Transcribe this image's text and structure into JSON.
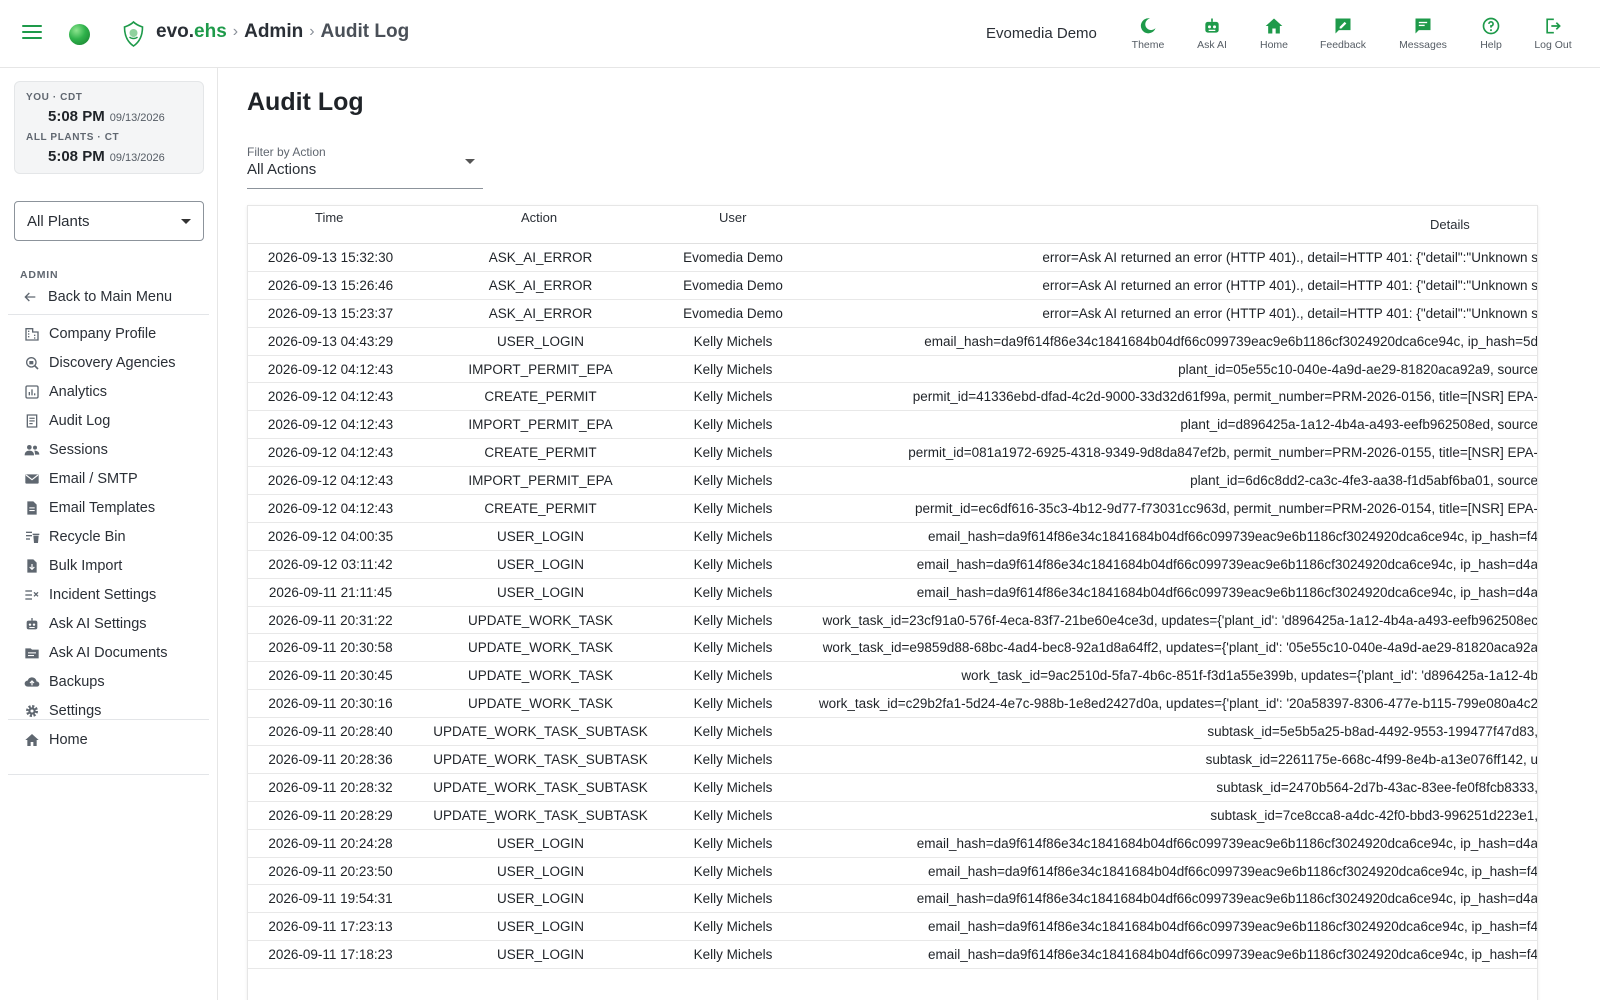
{
  "brand": {
    "prefix": "evo.",
    "suffix": "ehs",
    "crumb_admin": "Admin",
    "crumb_current": "Audit Log"
  },
  "account": {
    "name": "Evomedia Demo"
  },
  "actions": [
    {
      "label": "Theme",
      "icon": "moon-icon"
    },
    {
      "label": "Ask AI",
      "icon": "robot-icon"
    },
    {
      "label": "Home",
      "icon": "home-icon"
    },
    {
      "label": "Feedback",
      "icon": "feedback-icon"
    },
    {
      "label": "Messages",
      "icon": "message-icon"
    },
    {
      "label": "Help",
      "icon": "help-icon"
    },
    {
      "label": "Log Out",
      "icon": "logout-icon"
    }
  ],
  "clock": {
    "you_label": "YOU · CDT",
    "you_time": "5:08 PM",
    "you_date": "09/13/2026",
    "plants_label": "ALL PLANTS · CT",
    "plants_time": "5:08 PM",
    "plants_date": "09/13/2026"
  },
  "plant_select": {
    "value": "All Plants"
  },
  "sidebar": {
    "section_label": "ADMIN",
    "back_label": "Back to Main Menu",
    "items": [
      {
        "label": "Company Profile",
        "icon": "building-icon"
      },
      {
        "label": "Discovery Agencies",
        "icon": "agency-search-icon"
      },
      {
        "label": "Analytics",
        "icon": "analytics-icon"
      },
      {
        "label": "Audit Log",
        "icon": "document-icon"
      },
      {
        "label": "Sessions",
        "icon": "people-icon"
      },
      {
        "label": "Email / SMTP",
        "icon": "email-icon"
      },
      {
        "label": "Email Templates",
        "icon": "template-icon"
      },
      {
        "label": "Recycle Bin",
        "icon": "recycle-bin-icon"
      },
      {
        "label": "Bulk Import",
        "icon": "import-icon"
      },
      {
        "label": "Incident Settings",
        "icon": "incident-settings-icon"
      },
      {
        "label": "Ask AI Settings",
        "icon": "robot-icon"
      },
      {
        "label": "Ask AI Documents",
        "icon": "folder-icon"
      },
      {
        "label": "Backups",
        "icon": "cloud-backup-icon"
      },
      {
        "label": "Settings",
        "icon": "gear-icon"
      }
    ],
    "home_label": "Home"
  },
  "main": {
    "title": "Audit Log",
    "filter": {
      "label": "Filter by Action",
      "value": "All Actions"
    },
    "columns": {
      "time": "Time",
      "action": "Action",
      "user": "User",
      "details": "Details"
    },
    "rows": [
      {
        "time": "2026-09-13 15:32:30",
        "action": "ASK_AI_ERROR",
        "user": "Evomedia Demo",
        "details": "error=Ask AI returned an error (HTTP 401)., detail=HTTP 401: {\"detail\":\"Unknown s"
      },
      {
        "time": "2026-09-13 15:26:46",
        "action": "ASK_AI_ERROR",
        "user": "Evomedia Demo",
        "details": "error=Ask AI returned an error (HTTP 401)., detail=HTTP 401: {\"detail\":\"Unknown s"
      },
      {
        "time": "2026-09-13 15:23:37",
        "action": "ASK_AI_ERROR",
        "user": "Evomedia Demo",
        "details": "error=Ask AI returned an error (HTTP 401)., detail=HTTP 401: {\"detail\":\"Unknown s"
      },
      {
        "time": "2026-09-13 04:43:29",
        "action": "USER_LOGIN",
        "user": "Kelly Michels",
        "details": "email_hash=da9f614f86e34c1841684b04df66c099739eac9e6b1186cf3024920dca6ce94c, ip_hash=5d"
      },
      {
        "time": "2026-09-12 04:12:43",
        "action": "IMPORT_PERMIT_EPA",
        "user": "Kelly Michels",
        "details": "plant_id=05e55c10-040e-4a9d-ae29-81820aca92a9, source"
      },
      {
        "time": "2026-09-12 04:12:43",
        "action": "CREATE_PERMIT",
        "user": "Kelly Michels",
        "details": "permit_id=41336ebd-dfad-4c2d-9000-33d32d61f99a, permit_number=PRM-2026-0156, title=[NSR] EPA-"
      },
      {
        "time": "2026-09-12 04:12:43",
        "action": "IMPORT_PERMIT_EPA",
        "user": "Kelly Michels",
        "details": "plant_id=d896425a-1a12-4b4a-a493-eefb962508ed, source"
      },
      {
        "time": "2026-09-12 04:12:43",
        "action": "CREATE_PERMIT",
        "user": "Kelly Michels",
        "details": "permit_id=081a1972-6925-4318-9349-9d8da847ef2b, permit_number=PRM-2026-0155, title=[NSR] EPA-"
      },
      {
        "time": "2026-09-12 04:12:43",
        "action": "IMPORT_PERMIT_EPA",
        "user": "Kelly Michels",
        "details": "plant_id=6d6c8dd2-ca3c-4fe3-aa38-f1d5abf6ba01, source"
      },
      {
        "time": "2026-09-12 04:12:43",
        "action": "CREATE_PERMIT",
        "user": "Kelly Michels",
        "details": "permit_id=ec6df616-35c3-4b12-9d77-f73031cc963d, permit_number=PRM-2026-0154, title=[NSR] EPA-"
      },
      {
        "time": "2026-09-12 04:00:35",
        "action": "USER_LOGIN",
        "user": "Kelly Michels",
        "details": "email_hash=da9f614f86e34c1841684b04df66c099739eac9e6b1186cf3024920dca6ce94c, ip_hash=f4"
      },
      {
        "time": "2026-09-12 03:11:42",
        "action": "USER_LOGIN",
        "user": "Kelly Michels",
        "details": "email_hash=da9f614f86e34c1841684b04df66c099739eac9e6b1186cf3024920dca6ce94c, ip_hash=d4a"
      },
      {
        "time": "2026-09-11 21:11:45",
        "action": "USER_LOGIN",
        "user": "Kelly Michels",
        "details": "email_hash=da9f614f86e34c1841684b04df66c099739eac9e6b1186cf3024920dca6ce94c, ip_hash=d4a"
      },
      {
        "time": "2026-09-11 20:31:22",
        "action": "UPDATE_WORK_TASK",
        "user": "Kelly Michels",
        "details": "work_task_id=23cf91a0-576f-4eca-83f7-21be60e4ce3d, updates={'plant_id': 'd896425a-1a12-4b4a-a493-eefb962508ec"
      },
      {
        "time": "2026-09-11 20:30:58",
        "action": "UPDATE_WORK_TASK",
        "user": "Kelly Michels",
        "details": "work_task_id=e9859d88-68bc-4ad4-bec8-92a1d8a64ff2, updates={'plant_id': '05e55c10-040e-4a9d-ae29-81820aca92a"
      },
      {
        "time": "2026-09-11 20:30:45",
        "action": "UPDATE_WORK_TASK",
        "user": "Kelly Michels",
        "details": "work_task_id=9ac2510d-5fa7-4b6c-851f-f3d1a55e399b, updates={'plant_id': 'd896425a-1a12-4b"
      },
      {
        "time": "2026-09-11 20:30:16",
        "action": "UPDATE_WORK_TASK",
        "user": "Kelly Michels",
        "details": "work_task_id=c29b2fa1-5d24-4e7c-988b-1e8ed2427d0a, updates={'plant_id': '20a58397-8306-477e-b115-799e080a4c2"
      },
      {
        "time": "2026-09-11 20:28:40",
        "action": "UPDATE_WORK_TASK_SUBTASK",
        "user": "Kelly Michels",
        "details": "subtask_id=5e5b5a25-b8ad-4492-9553-199477f47d83,"
      },
      {
        "time": "2026-09-11 20:28:36",
        "action": "UPDATE_WORK_TASK_SUBTASK",
        "user": "Kelly Michels",
        "details": "subtask_id=2261175e-668c-4f99-8e4b-a13e076ff142, u"
      },
      {
        "time": "2026-09-11 20:28:32",
        "action": "UPDATE_WORK_TASK_SUBTASK",
        "user": "Kelly Michels",
        "details": "subtask_id=2470b564-2d7b-43ac-83ee-fe0f8fcb8333,"
      },
      {
        "time": "2026-09-11 20:28:29",
        "action": "UPDATE_WORK_TASK_SUBTASK",
        "user": "Kelly Michels",
        "details": "subtask_id=7ce8cca8-a4dc-42f0-bbd3-996251d223e1,"
      },
      {
        "time": "2026-09-11 20:24:28",
        "action": "USER_LOGIN",
        "user": "Kelly Michels",
        "details": "email_hash=da9f614f86e34c1841684b04df66c099739eac9e6b1186cf3024920dca6ce94c, ip_hash=d4a"
      },
      {
        "time": "2026-09-11 20:23:50",
        "action": "USER_LOGIN",
        "user": "Kelly Michels",
        "details": "email_hash=da9f614f86e34c1841684b04df66c099739eac9e6b1186cf3024920dca6ce94c, ip_hash=f4"
      },
      {
        "time": "2026-09-11 19:54:31",
        "action": "USER_LOGIN",
        "user": "Kelly Michels",
        "details": "email_hash=da9f614f86e34c1841684b04df66c099739eac9e6b1186cf3024920dca6ce94c, ip_hash=d4a"
      },
      {
        "time": "2026-09-11 17:23:13",
        "action": "USER_LOGIN",
        "user": "Kelly Michels",
        "details": "email_hash=da9f614f86e34c1841684b04df66c099739eac9e6b1186cf3024920dca6ce94c, ip_hash=f4"
      },
      {
        "time": "2026-09-11 17:18:23",
        "action": "USER_LOGIN",
        "user": "Kelly Michels",
        "details": "email_hash=da9f614f86e34c1841684b04df66c099739eac9e6b1186cf3024920dca6ce94c, ip_hash=f4"
      }
    ]
  },
  "colors": {
    "accent": "#1e9a4a",
    "text": "#1f2328",
    "muted": "#606770",
    "border": "#e6e6e6"
  }
}
